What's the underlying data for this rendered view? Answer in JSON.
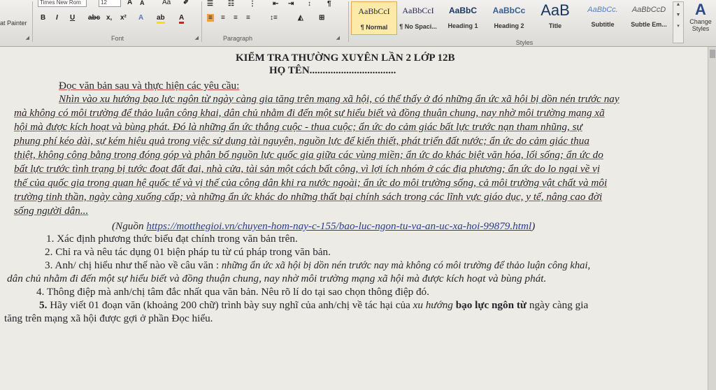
{
  "ribbon": {
    "clipboard": {
      "format_painter": "at Painter"
    },
    "font": {
      "name_value": "Times New Rom",
      "size_value": "12",
      "change_case": "Aa",
      "label": "Font"
    },
    "paragraph": {
      "label": "Paragraph"
    },
    "styles": {
      "label": "Styles",
      "items": [
        {
          "sample": "AaBbCcI",
          "name": "¶ Normal"
        },
        {
          "sample": "AaBbCcI",
          "name": "¶ No Spaci..."
        },
        {
          "sample": "AaBbC",
          "name": "Heading 1"
        },
        {
          "sample": "AaBbCc",
          "name": "Heading 2"
        },
        {
          "sample": "AaB",
          "name": "Title"
        },
        {
          "sample": "AaBbCc.",
          "name": "Subtitle"
        },
        {
          "sample": "AaBbCcD",
          "name": "Subtle Em..."
        }
      ],
      "change_styles_line1": "Change",
      "change_styles_line2": "Styles"
    }
  },
  "document": {
    "title": "KIỂM TRA THƯỜNG XUYÊN LẦN 2 LỚP 12B",
    "name_line": "HỌ TÊN.................................",
    "instruction": "Đọc văn bản sau và thực hiện các yêu cầu:",
    "passage_lines": [
      "Nhìn vào xu hướng bạo lực ngôn từ ngày càng gia tăng trên mạng xã hội, có thể thấy ở đó những ẩn ức xã hội bị dồn nén trước nay",
      "mà không có môi trường để thảo luận công khai, dân chủ nhằm đi đến một sự hiểu biết và đồng thuận chung, nay nhờ môi trường mạng xã",
      "hội mà được kích hoạt và bùng phát. Đó là những ẩn ức thắng cuộc - thua cuộc; ẩn ức do cảm giác bất lực trước nạn tham nhũng, sự",
      "phung phí kéo dài, sự kém hiệu quả trong việc sử dụng tài nguyên, nguồn lực để kiến thiết, phát triển đất nước; ẩn ức do cảm giác thua",
      "thiệt, không công bằng trong đóng góp và phân bổ nguồn lực quốc gia giữa các vùng miền; ẩn ức do khác biệt văn hóa, lối sống; ẩn ức do",
      "bất lực trước tình trạng bị tước đoạt đất đai, nhà cửa, tài sản một cách bất công, vì lợi ích nhóm ở các địa phương; ẩn ức do lo ngại về vị",
      "thế của quốc gia trong quan hệ quốc tế và vị thế của công dân khi ra nước ngoài; ẩn ức do môi trường sống, cả môi trường vật chất và môi",
      "trường tinh thần, ngày càng xuống cấp; và những ẩn ức khác do những thất bại chính sách trong các lĩnh vực giáo dục, y tế, nâng cao đời",
      "sống người dân..."
    ],
    "source_prefix": "(Nguồn ",
    "source_url": "https://motthegioi.vn/chuyen-hom-nay-c-155/bao-luc-ngon-tu-va-an-uc-xa-hoi-99879.html",
    "source_suffix": ")",
    "q1": "1. Xác định phương thức biểu đạt chính trong văn bản trên.",
    "q2": "2. Chỉ ra và nêu tác dụng 01 biện pháp tu từ cú pháp trong văn bản.",
    "q3_prefix": "3. Anh/ chị hiểu như thế nào về câu văn :",
    "q3_quote_line1": "những ẩn ức xã hội bị dồn nén trước nay mà không có môi trường để thảo luận công khai,",
    "q3_quote_line2": "dân chủ nhằm đi đến một sự hiểu biết và đồng thuận chung, nay nhờ môi trường mạng xã hội mà được kích hoạt và bùng phát.",
    "q4": "4. Thông điệp mà anh/chị tâm đắc nhất qua văn bản. Nêu rõ lí do tại sao chọn thông điệp đó.",
    "q5_num": "5.",
    "q5_part1": " Hãy viết 01 đoạn văn (khoảng 200 chữ) trình bày suy nghĩ của anh/chị về tác hại của ",
    "q5_italic": "xu hướng",
    "q5_bold": " bạo lực ngôn từ",
    "q5_part2": " ngày càng gia",
    "q5_line2": "tăng trên mạng xã hội được gợi ở phần Đọc hiểu."
  }
}
